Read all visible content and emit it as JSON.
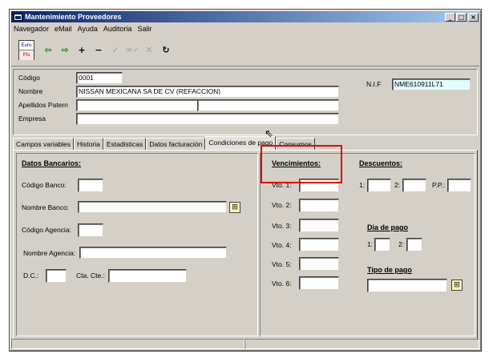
{
  "window": {
    "title": "Mantenimiento Proveedores",
    "min_label": "_",
    "max_label": "□",
    "close_label": "×"
  },
  "menu": [
    "Navegador",
    "eMail",
    "Ayuda",
    "Auditoria",
    "Salir"
  ],
  "toolbar": {
    "euro_label": "Euro",
    "pts_label": "Pts",
    "buttons": [
      {
        "glyph": "⇦",
        "icon": "arrow-left-icon"
      },
      {
        "glyph": "⇨",
        "icon": "arrow-right-icon"
      },
      {
        "glyph": "+",
        "icon": "plus-icon"
      },
      {
        "glyph": "−",
        "icon": "minus-icon"
      },
      {
        "glyph": "✓",
        "icon": "check-icon"
      },
      {
        "glyph": "≫✓",
        "icon": "check-all-icon"
      },
      {
        "glyph": "✕",
        "icon": "cancel-icon"
      },
      {
        "glyph": "↻",
        "icon": "refresh-icon"
      }
    ]
  },
  "header": {
    "codigo_label": "Código",
    "codigo_value": "0001",
    "nombre_label": "Nombre",
    "nombre_value": "NISSAN MEXICANA SA DE CV (REFACCION)",
    "apellidos_label": "Apellidos Patern",
    "empresa_label": "Empresa",
    "nif_label": "N.I.F",
    "nif_value": "NME610911L71"
  },
  "tabs": [
    {
      "label": "Campos variables",
      "active": false
    },
    {
      "label": "Historia",
      "active": false
    },
    {
      "label": "Estadisticas",
      "active": false
    },
    {
      "label": "Datos facturación",
      "active": false
    },
    {
      "label": "Condiciones de pago",
      "active": true
    },
    {
      "label": "Consumos",
      "active": false
    }
  ],
  "bank": {
    "heading": "Datos Bancarios:",
    "codigo_banco_label": "Código Banco:",
    "nombre_banco_label": "Nombre Banco:",
    "codigo_agencia_label": "Código Agencia:",
    "nombre_agencia_label": "Nombre Agencia:",
    "dc_label": "D.C.:",
    "cta_label": "Cta. Cte.:"
  },
  "vencimientos": {
    "heading": "Vencimientos:",
    "labels": [
      "Vto. 1:",
      "Vto. 2:",
      "Vto. 3:",
      "Vto. 4:",
      "Vto. 5:",
      "Vto. 6:"
    ]
  },
  "descuentos": {
    "heading": "Descuentos:",
    "d1_label": "1:",
    "d2_label": "2:",
    "pp_label": "P.P.:"
  },
  "dia_pago": {
    "heading": "Dia de pago",
    "d1_label": "1:",
    "d2_label": "2:"
  },
  "tipo_pago": {
    "heading": "Tipo de pago"
  }
}
